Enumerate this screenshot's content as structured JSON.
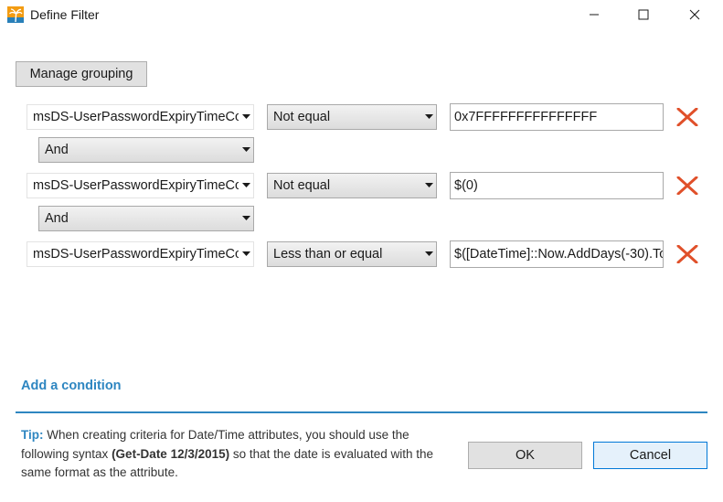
{
  "window": {
    "title": "Define Filter",
    "icon": "palm-tree-sunset-icon"
  },
  "toolbar": {
    "manage_grouping_label": "Manage grouping"
  },
  "conditions": [
    {
      "attribute": "msDS-UserPasswordExpiryTimeCo",
      "operator": "Not equal",
      "value": "0x7FFFFFFFFFFFFFFF"
    },
    {
      "attribute": "msDS-UserPasswordExpiryTimeCo",
      "operator": "Not equal",
      "value": "$(0)"
    },
    {
      "attribute": "msDS-UserPasswordExpiryTimeCo",
      "operator": "Less than or equal",
      "value": "$([DateTime]::Now.AddDays(-30).To"
    }
  ],
  "logic": [
    "And",
    "And"
  ],
  "add_condition_label": "Add a condition",
  "tip": {
    "label": "Tip:",
    "text_before": " When creating criteria for Date/Time attributes, you should use the following syntax ",
    "syntax": "(Get-Date 12/3/2015)",
    "text_after": " so that the date is evaluated with the same format as the attribute."
  },
  "buttons": {
    "ok": "OK",
    "cancel": "Cancel"
  },
  "colors": {
    "accent": "#2e86c1",
    "delete": "#e0502a"
  }
}
